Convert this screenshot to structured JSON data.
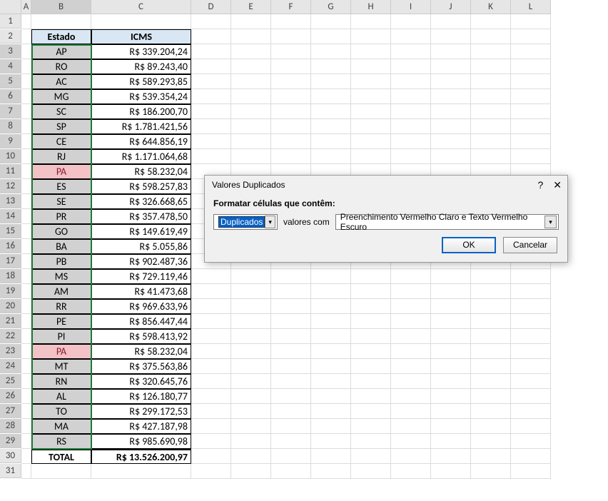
{
  "columns": [
    "A",
    "B",
    "C",
    "D",
    "E",
    "F",
    "G",
    "H",
    "I",
    "J",
    "K",
    "L"
  ],
  "col_widths_class": [
    "wA",
    "wB",
    "wC",
    "wR",
    "wR",
    "wR",
    "wR",
    "wR",
    "wR",
    "wR",
    "wR",
    "wR"
  ],
  "row_count": 31,
  "selected_col": "B",
  "selected_rows_from": 3,
  "selected_rows_to": 29,
  "headers": {
    "estado": "Estado",
    "icms": "ICMS"
  },
  "rows": [
    {
      "estado": "AP",
      "icms": "R$ 339.204,24",
      "dup": false
    },
    {
      "estado": "RO",
      "icms": "R$ 89.243,40",
      "dup": false
    },
    {
      "estado": "AC",
      "icms": "R$ 589.293,85",
      "dup": false
    },
    {
      "estado": "MG",
      "icms": "R$ 539.354,24",
      "dup": false
    },
    {
      "estado": "SC",
      "icms": "R$ 186.200,70",
      "dup": false
    },
    {
      "estado": "SP",
      "icms": "R$ 1.781.421,56",
      "dup": false
    },
    {
      "estado": "CE",
      "icms": "R$ 644.856,19",
      "dup": false
    },
    {
      "estado": "RJ",
      "icms": "R$ 1.171.064,68",
      "dup": false
    },
    {
      "estado": "PA",
      "icms": "R$ 58.232,04",
      "dup": true
    },
    {
      "estado": "ES",
      "icms": "R$ 598.257,83",
      "dup": false
    },
    {
      "estado": "SE",
      "icms": "R$ 326.668,65",
      "dup": false
    },
    {
      "estado": "PR",
      "icms": "R$ 357.478,50",
      "dup": false
    },
    {
      "estado": "GO",
      "icms": "R$ 149.619,49",
      "dup": false
    },
    {
      "estado": "BA",
      "icms": "R$ 5.055,86",
      "dup": false
    },
    {
      "estado": "PB",
      "icms": "R$ 902.487,36",
      "dup": false
    },
    {
      "estado": "MS",
      "icms": "R$ 729.119,46",
      "dup": false
    },
    {
      "estado": "AM",
      "icms": "R$ 41.473,68",
      "dup": false
    },
    {
      "estado": "RR",
      "icms": "R$ 969.633,96",
      "dup": false
    },
    {
      "estado": "PE",
      "icms": "R$ 856.447,44",
      "dup": false
    },
    {
      "estado": "PI",
      "icms": "R$ 598.413,92",
      "dup": false
    },
    {
      "estado": "PA",
      "icms": "R$ 58.232,04",
      "dup": true
    },
    {
      "estado": "MT",
      "icms": "R$ 375.563,86",
      "dup": false
    },
    {
      "estado": "RN",
      "icms": "R$ 320.645,76",
      "dup": false
    },
    {
      "estado": "AL",
      "icms": "R$ 126.180,77",
      "dup": false
    },
    {
      "estado": "TO",
      "icms": "R$ 299.172,53",
      "dup": false
    },
    {
      "estado": "MA",
      "icms": "R$ 427.187,98",
      "dup": false
    },
    {
      "estado": "RS",
      "icms": "R$ 985.690,98",
      "dup": false
    }
  ],
  "total": {
    "label": "TOTAL",
    "value": "R$ 13.526.200,97"
  },
  "dialog": {
    "title": "Valores Duplicados",
    "help_icon": "?",
    "close_icon": "✕",
    "instruction": "Formatar células que contêm:",
    "dropdown1": "Duplicados",
    "middle_text": "valores com",
    "dropdown2": "Preenchimento Vermelho Claro e Texto Vermelho Escuro",
    "ok": "OK",
    "cancel": "Cancelar"
  }
}
